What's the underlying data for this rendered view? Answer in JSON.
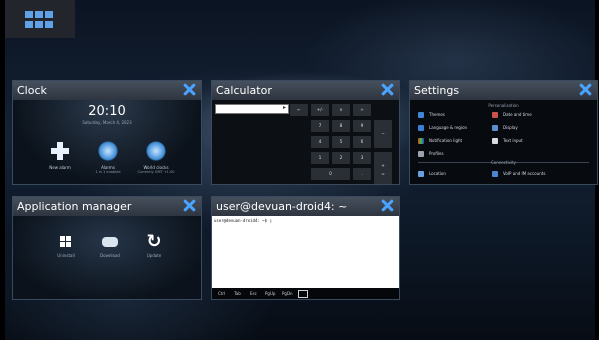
{
  "launcher": {
    "label": ""
  },
  "clock": {
    "title": "Clock",
    "time": "20:10",
    "date": "Saturday, March 4, 2023",
    "actions": [
      {
        "label": "New alarm",
        "sub": ""
      },
      {
        "label": "Alarms",
        "sub": "1 in 1 enabled"
      },
      {
        "label": "World clocks",
        "sub": "Currently GMT +1:00"
      }
    ]
  },
  "calculator": {
    "title": "Calculator",
    "keys": [
      "←",
      "+/-",
      "×",
      "÷",
      "7",
      "8",
      "9",
      "−",
      "4",
      "5",
      "6",
      "+",
      "1",
      "2",
      "3",
      "=",
      "0",
      "."
    ]
  },
  "settings": {
    "title": "Settings",
    "section1": "Personalisation",
    "section2": "Connectivity",
    "items": [
      {
        "label": "Themes",
        "icon": "themes-icon"
      },
      {
        "label": "Date and time",
        "icon": "date-time-icon"
      },
      {
        "label": "Language & region",
        "icon": "language-icon"
      },
      {
        "label": "Display",
        "icon": "display-icon"
      },
      {
        "label": "Notification light",
        "icon": "notification-light-icon"
      },
      {
        "label": "Text input",
        "icon": "text-input-icon"
      },
      {
        "label": "Profiles",
        "icon": "profiles-icon"
      },
      {
        "label": "Location",
        "icon": "location-icon"
      },
      {
        "label": "VoIP and IM accounts",
        "icon": "voip-icon"
      }
    ]
  },
  "appmanager": {
    "title": "Application manager",
    "items": [
      "Uninstall",
      "Download",
      "Update"
    ]
  },
  "terminal": {
    "title": "user@devuan-droid4: ~",
    "prompt": "user@devuan-droid4: ~$ ▯",
    "keys": [
      "Ctrl",
      "Tab",
      "Esc",
      "PgUp",
      "PgDn"
    ]
  }
}
